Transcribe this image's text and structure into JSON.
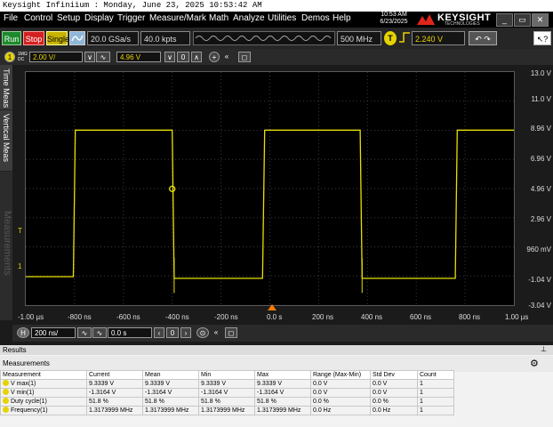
{
  "window": {
    "title": "Keysight Infiniium : Monday, June 23, 2025 10:53:42 AM"
  },
  "menu": [
    "File",
    "Control",
    "Setup",
    "Display",
    "Trigger",
    "Measure/Mark",
    "Math",
    "Analyze",
    "Utilities",
    "Demos",
    "Help"
  ],
  "clock": {
    "time": "10:53 AM",
    "date": "6/23/2025"
  },
  "brand": {
    "name": "KEYSIGHT",
    "sub": "TECHNOLOGIES"
  },
  "toolbar": {
    "run": "Run",
    "stop": "Stop",
    "single": "Single",
    "sample_rate": "20.0 GSa/s",
    "memory_depth": "40.0 kpts",
    "bandwidth": "500 MHz",
    "trigger_source": "T",
    "trigger_level": "2.240 V"
  },
  "channel": {
    "number": "1",
    "coupling_top": "1MΩ",
    "coupling_bottom": "DC",
    "scale": "2.00 V/",
    "offset": "4.96 V",
    "zero": "0"
  },
  "sidetabs": [
    "Time Meas",
    "Vertical Meas",
    "Measurements"
  ],
  "plot": {
    "y_labels": [
      "13.0 V",
      "11.0 V",
      "8.96 V",
      "6.96 V",
      "4.96 V",
      "2.96 V",
      "960 mV",
      "-1.04 V",
      "-3.04 V"
    ],
    "x_labels": [
      "-1.00 µs",
      "-800 ns",
      "-600 ns",
      "-400 ns",
      "-200 ns",
      "0.0 s",
      "200 ns",
      "400 ns",
      "600 ns",
      "800 ns",
      "1.00 µs"
    ],
    "marker_trigger": "T",
    "marker_ground": "1",
    "marker_channel": "1",
    "trace_color": "#e8e000",
    "grid_color": "#3a3a3a"
  },
  "horizontal": {
    "label": "H",
    "scale": "200 ns/",
    "position": "0.0 s",
    "zero": "0"
  },
  "results": {
    "panel_title": "Results",
    "section_title": "Measurements",
    "columns": [
      "Measurement",
      "Current",
      "Mean",
      "Min",
      "Max",
      "Range (Max-Min)",
      "Std Dev",
      "Count"
    ],
    "rows": [
      [
        "V max(1)",
        "9.3339 V",
        "9.3339 V",
        "9.3339 V",
        "9.3339 V",
        "0.0 V",
        "0.0 V",
        "1"
      ],
      [
        "V min(1)",
        "-1.3164 V",
        "-1.3164 V",
        "-1.3164 V",
        "-1.3164 V",
        "0.0 V",
        "0.0 V",
        "1"
      ],
      [
        "Duty cycle(1)",
        "51.8 %",
        "51.8 %",
        "51.8 %",
        "51.8 %",
        "0.0 %",
        "0.0 %",
        "1"
      ],
      [
        "Frequency(1)",
        "1.3173999 MHz",
        "1.3173999 MHz",
        "1.3173999 MHz",
        "1.3173999 MHz",
        "0.0 Hz",
        "0.0 Hz",
        "1"
      ]
    ]
  },
  "chart_data": {
    "type": "line",
    "xlabel": "",
    "ylabel": "",
    "xlim": [
      -1000,
      1000
    ],
    "ylim": [
      -3.04,
      13.0
    ],
    "grid": true,
    "series": [
      {
        "x": [
          -1000,
          -805,
          -797,
          -400,
          -392,
          -30,
          -21,
          370,
          378,
          760,
          768,
          1000
        ],
        "values": [
          -1.08,
          -1.08,
          9.0,
          9.0,
          -1.2,
          -1.2,
          9.0,
          9.0,
          -1.2,
          -1.2,
          9.0,
          9.0
        ]
      }
    ]
  }
}
